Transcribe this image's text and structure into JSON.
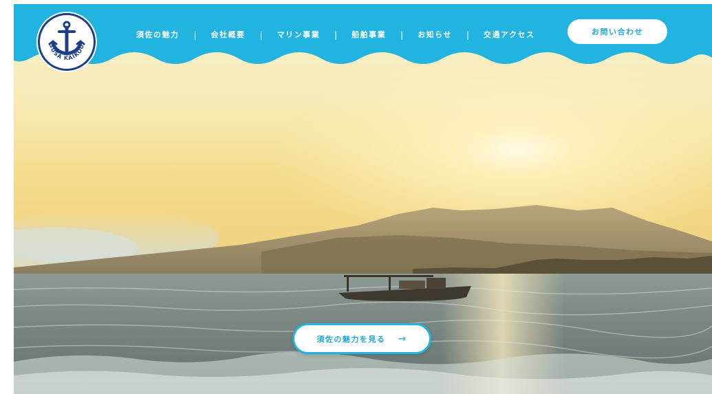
{
  "colors": {
    "header_blue": "#22b4e0",
    "logo_navy": "#1d3f86",
    "button_text": "#1fa8d8"
  },
  "logo": {
    "text": "SUSA KAIKOU",
    "icon": "anchor-icon"
  },
  "nav": {
    "items": [
      {
        "label": "須佐の魅力"
      },
      {
        "label": "会社概要"
      },
      {
        "label": "マリン事業"
      },
      {
        "label": "船舶事業"
      },
      {
        "label": "お知らせ"
      },
      {
        "label": "交通アクセス"
      }
    ],
    "separator": "|"
  },
  "header": {
    "contact_label": "お問い合わせ"
  },
  "hero": {
    "cta_label": "須佐の魅力を見る",
    "cta_arrow": "→"
  }
}
